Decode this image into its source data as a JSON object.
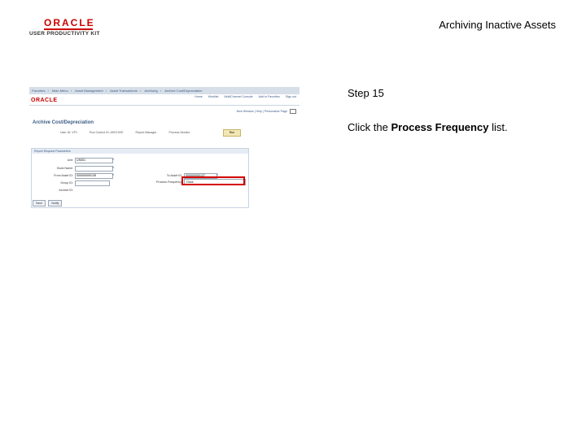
{
  "logo": {
    "brand": "ORACLE",
    "product": "USER PRODUCTIVITY KIT"
  },
  "document_title": "Archiving Inactive Assets",
  "step": {
    "title": "Step 15"
  },
  "instruction": {
    "prefix": "Click the",
    "target": "Process Frequency",
    "suffix": "list."
  },
  "screenshot": {
    "nav_items": [
      "Favorites",
      "Main Menu",
      "Asset Management",
      "Asset Transactions",
      "Archiving",
      "Archive Cost/Depreciation"
    ],
    "brand": "ORACLE",
    "menu_links": [
      "Home",
      "Worklist",
      "MultiChannel Console",
      "Add to Favorites",
      "Sign out"
    ],
    "new_window": "New Window | Help | Personalize Page",
    "page_title": "Archive Cost/Depreciation",
    "info": [
      "User ID: VP1",
      "Run Control ID: ARCHIVE",
      "Report Manager",
      "Process Monitor"
    ],
    "run_button": "Run",
    "section_title": "Report Request Parameters",
    "fields": {
      "unit_label": "Unit:",
      "unit_value": "US001",
      "book_label": "Book Name:",
      "book_value": "",
      "from_asset_label": "From Asset ID:",
      "from_asset_value": "000000000135",
      "to_asset_label": "To Asset ID:",
      "to_asset_value": "000000000137",
      "group_label": "Group ID:",
      "group_value": "",
      "process_freq_label": "Process Frequency:",
      "process_freq_value": "Once",
      "archive_id_label": "Archive ID:"
    },
    "buttons": [
      "Save",
      "Notify"
    ]
  }
}
